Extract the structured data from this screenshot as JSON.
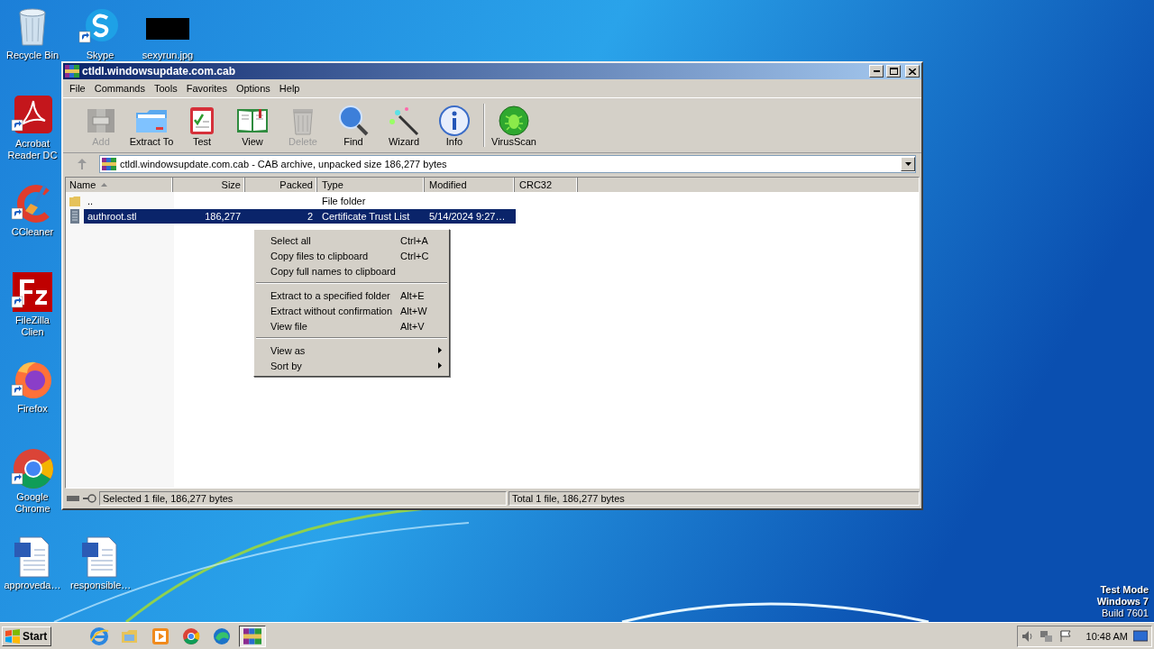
{
  "desktop_icons": [
    {
      "kind": "recycle",
      "label": "Recycle Bin"
    },
    {
      "kind": "skype",
      "label": "Skype"
    },
    {
      "kind": "image",
      "label": "sexyrun.jpg"
    },
    {
      "kind": "acrobat",
      "label": "Acrobat Reader DC"
    },
    {
      "kind": "ccleaner",
      "label": "CCleaner"
    },
    {
      "kind": "filezilla",
      "label": "FileZilla Clien"
    },
    {
      "kind": "firefox",
      "label": "Firefox"
    },
    {
      "kind": "chrome",
      "label": "Google Chrome"
    },
    {
      "kind": "word",
      "label": "approveda…"
    },
    {
      "kind": "word",
      "label": "responsible…"
    }
  ],
  "window": {
    "title": "ctldl.windowsupdate.com.cab",
    "menu": [
      "File",
      "Commands",
      "Tools",
      "Favorites",
      "Options",
      "Help"
    ],
    "toolbar": [
      {
        "kind": "add",
        "label": "Add",
        "disabled": true
      },
      {
        "kind": "extract",
        "label": "Extract To",
        "disabled": false
      },
      {
        "kind": "test",
        "label": "Test",
        "disabled": false
      },
      {
        "kind": "view",
        "label": "View",
        "disabled": false
      },
      {
        "kind": "delete",
        "label": "Delete",
        "disabled": true
      },
      {
        "kind": "find",
        "label": "Find",
        "disabled": false
      },
      {
        "kind": "wizard",
        "label": "Wizard",
        "disabled": false
      },
      {
        "kind": "info",
        "label": "Info",
        "disabled": false
      },
      {
        "kind": "virusscan",
        "label": "VirusScan",
        "disabled": false
      }
    ],
    "address": "ctldl.windowsupdate.com.cab - CAB archive, unpacked size 186,277 bytes",
    "columns": [
      {
        "label": "Name",
        "sorted": true
      },
      {
        "label": "Size",
        "sorted": false
      },
      {
        "label": "Packed",
        "sorted": false
      },
      {
        "label": "Type",
        "sorted": false
      },
      {
        "label": "Modified",
        "sorted": false
      },
      {
        "label": "CRC32",
        "sorted": false
      }
    ],
    "rows": [
      {
        "kind": "folder",
        "name": "..",
        "type": "File folder",
        "selected": false
      },
      {
        "kind": "file",
        "name": "authroot.stl",
        "size": "186,277",
        "packed": "2",
        "type": "Certificate Trust List",
        "modified": "5/14/2024 9:27…",
        "selected": true
      }
    ],
    "context_menu": [
      [
        {
          "label": "Select all",
          "shortcut": "Ctrl+A",
          "submenu": false
        },
        {
          "label": "Copy files to clipboard",
          "shortcut": "Ctrl+C",
          "submenu": false
        },
        {
          "label": "Copy full names to clipboard",
          "submenu": false
        }
      ],
      [
        {
          "label": "Extract to a specified folder",
          "shortcut": "Alt+E",
          "submenu": false
        },
        {
          "label": "Extract without confirmation",
          "shortcut": "Alt+W",
          "submenu": false
        },
        {
          "label": "View file",
          "shortcut": "Alt+V",
          "submenu": false
        }
      ],
      [
        {
          "label": "View as",
          "submenu": true
        },
        {
          "label": "Sort by",
          "submenu": true
        }
      ]
    ],
    "status": [
      "Selected 1 file, 186,277 bytes",
      "Total 1 file, 186,277 bytes"
    ]
  },
  "os_notice": [
    "Test Mode",
    "Windows 7",
    "Build 7601"
  ],
  "taskbar": {
    "start": "Start",
    "apps": [
      {
        "kind": "ie",
        "selected": false
      },
      {
        "kind": "explorer",
        "selected": false
      },
      {
        "kind": "media",
        "selected": false
      },
      {
        "kind": "chrome",
        "selected": false
      },
      {
        "kind": "edge",
        "selected": false
      },
      {
        "kind": "winrar",
        "selected": true
      }
    ],
    "clock": "10:48 AM"
  }
}
